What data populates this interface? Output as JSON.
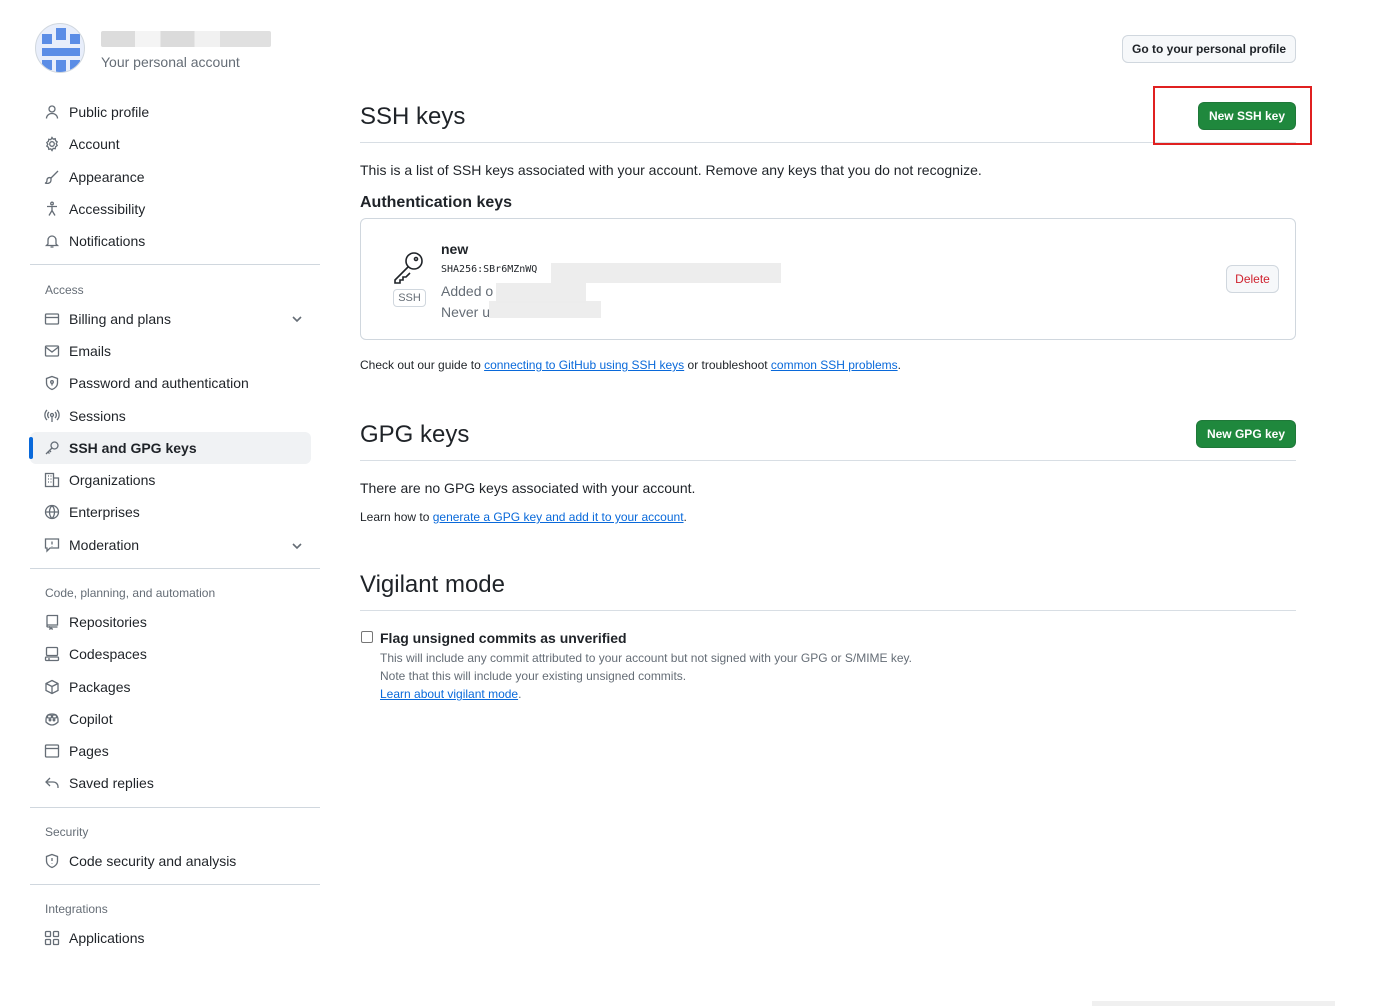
{
  "header": {
    "account_subtitle": "Your personal account",
    "profile_button": "Go to your personal profile"
  },
  "sidebar": {
    "top_items": [
      {
        "label": "Public profile",
        "icon": "person-icon"
      },
      {
        "label": "Account",
        "icon": "gear-icon"
      },
      {
        "label": "Appearance",
        "icon": "paintbrush-icon"
      },
      {
        "label": "Accessibility",
        "icon": "accessibility-icon"
      },
      {
        "label": "Notifications",
        "icon": "bell-icon"
      }
    ],
    "access": {
      "label": "Access",
      "items": [
        {
          "label": "Billing and plans",
          "icon": "credit-card-icon"
        },
        {
          "label": "Emails",
          "icon": "mail-icon"
        },
        {
          "label": "Password and authentication",
          "icon": "shield-lock-icon"
        },
        {
          "label": "Sessions",
          "icon": "broadcast-icon"
        },
        {
          "label": "SSH and GPG keys",
          "icon": "key-icon"
        },
        {
          "label": "Organizations",
          "icon": "organization-icon"
        },
        {
          "label": "Enterprises",
          "icon": "globe-icon"
        },
        {
          "label": "Moderation",
          "icon": "report-icon"
        }
      ]
    },
    "code": {
      "label": "Code, planning, and automation",
      "items": [
        {
          "label": "Repositories",
          "icon": "repo-icon"
        },
        {
          "label": "Codespaces",
          "icon": "codespaces-icon"
        },
        {
          "label": "Packages",
          "icon": "package-icon"
        },
        {
          "label": "Copilot",
          "icon": "copilot-icon"
        },
        {
          "label": "Pages",
          "icon": "browser-icon"
        },
        {
          "label": "Saved replies",
          "icon": "reply-icon"
        }
      ]
    },
    "security": {
      "label": "Security",
      "items": [
        {
          "label": "Code security and analysis",
          "icon": "shield-icon"
        }
      ]
    },
    "integrations": {
      "label": "Integrations",
      "items": [
        {
          "label": "Applications",
          "icon": "apps-icon"
        }
      ]
    }
  },
  "ssh": {
    "title": "SSH keys",
    "new_button": "New SSH key",
    "description": "This is a list of SSH keys associated with your account. Remove any keys that you do not recognize.",
    "auth_heading": "Authentication keys",
    "key": {
      "name": "new",
      "fingerprint_prefix": "SHA256:SBr6MZnWQ",
      "added_prefix": "Added o",
      "used_prefix": "Never u",
      "badge": "SSH",
      "delete_button": "Delete"
    },
    "guide_prefix": "Check out our guide to ",
    "guide_link1": "connecting to GitHub using SSH keys",
    "guide_mid": " or troubleshoot ",
    "guide_link2": "common SSH problems",
    "guide_suffix": "."
  },
  "gpg": {
    "title": "GPG keys",
    "new_button": "New GPG key",
    "empty": "There are no GPG keys associated with your account.",
    "learn_prefix": "Learn how to ",
    "learn_link": "generate a GPG key and add it to your account",
    "learn_suffix": "."
  },
  "vigilant": {
    "title": "Vigilant mode",
    "checkbox_label": "Flag unsigned commits as unverified",
    "note1": "This will include any commit attributed to your account but not signed with your GPG or S/MIME key.",
    "note2": "Note that this will include your existing unsigned commits.",
    "learn_link": "Learn about vigilant mode",
    "learn_suffix": "."
  },
  "colors": {
    "accent": "#0969da",
    "primary_button": "#1f883d",
    "danger": "#cf222e",
    "highlight_box": "#e02020"
  }
}
